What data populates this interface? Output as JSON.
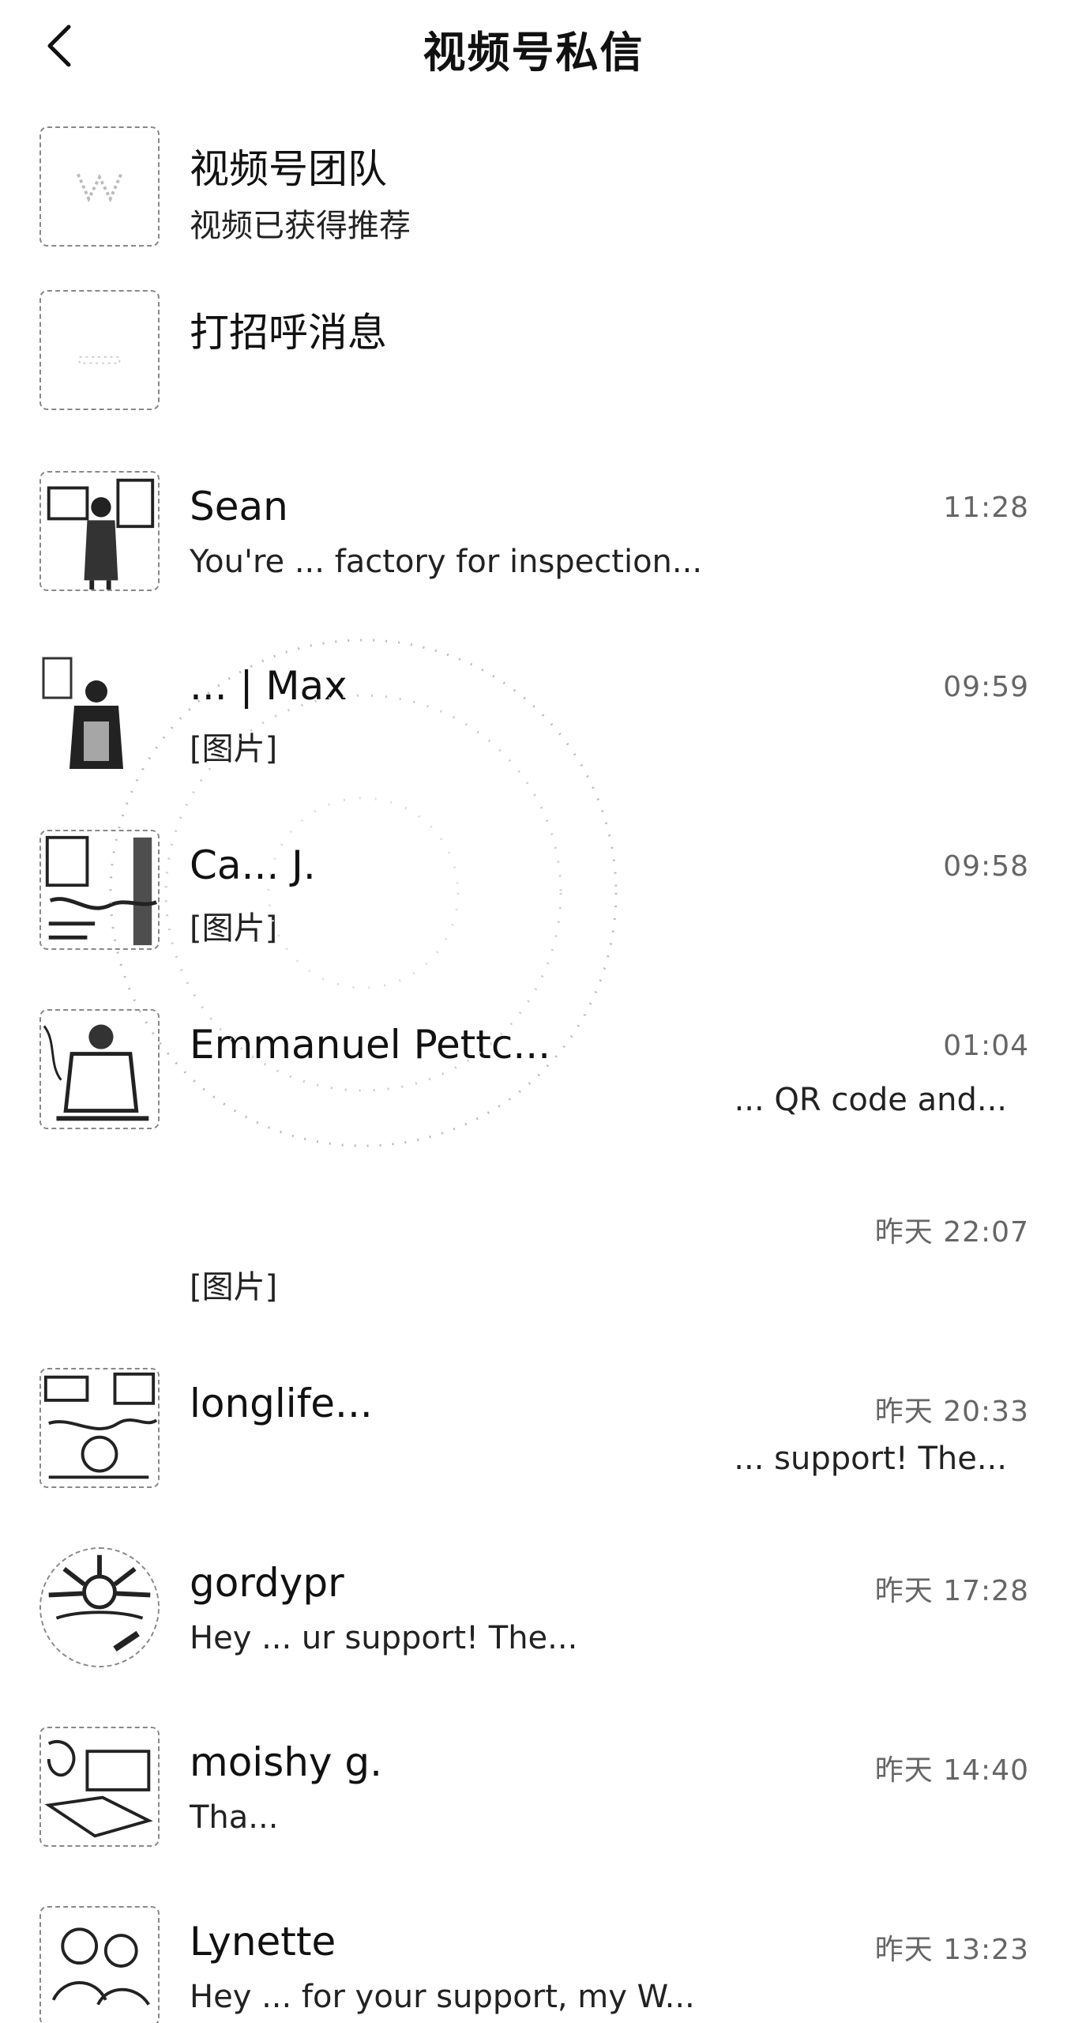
{
  "header": {
    "title": "视频号私信",
    "back_icon": "chevron-left-icon"
  },
  "conversations": [
    {
      "name": "视频号团队",
      "preview": "视频已获得推荐",
      "time": ""
    },
    {
      "name": "打招呼消息",
      "preview": "",
      "time": ""
    },
    {
      "name": "Sean",
      "preview": "You're ... factory for inspection...",
      "time": "11:28"
    },
    {
      "name": "... | Max",
      "preview": "[图片]",
      "time": "09:59"
    },
    {
      "name": "Ca... J.",
      "preview": "[图片]",
      "time": "09:58"
    },
    {
      "name": "Emmanuel Pettc...",
      "preview": "... QR code and...",
      "time": "01:04"
    },
    {
      "name": "",
      "preview": "[图片]",
      "time": "昨天 22:07"
    },
    {
      "name": "longlife...",
      "preview": "... support!  The...",
      "time": "昨天 20:33"
    },
    {
      "name": "gordypr",
      "preview": "Hey ... ur support!  The...",
      "time": "昨天 17:28"
    },
    {
      "name": "moishy g.",
      "preview": "Tha...",
      "time": "昨天 14:40"
    },
    {
      "name": "Lynette",
      "preview": "Hey ... for your support, my W...",
      "time": "昨天 13:23"
    }
  ]
}
